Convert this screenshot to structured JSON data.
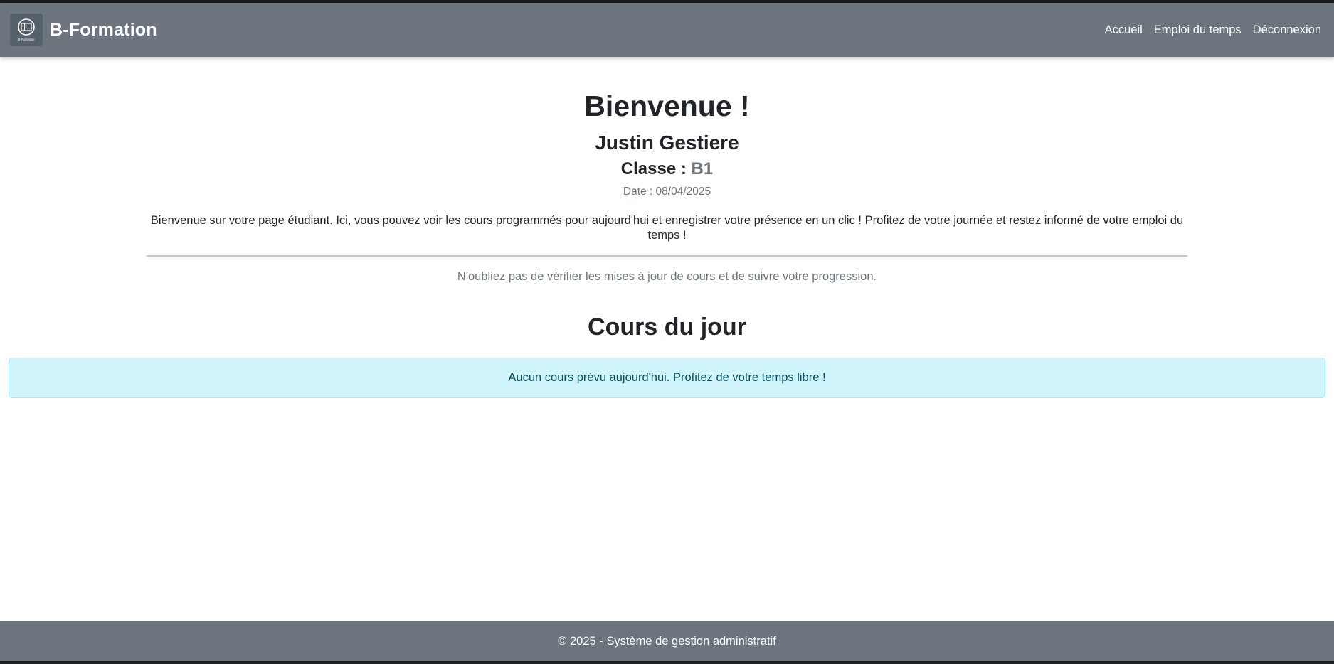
{
  "navbar": {
    "brand": "B-Formation",
    "logo_icon": "b-formation-logo-icon",
    "logo_caption": "B-Formation",
    "links": [
      "Accueil",
      "Emploi du temps",
      "Déconnexion"
    ]
  },
  "welcome": {
    "title": "Bienvenue !",
    "student_name": "Justin Gestiere",
    "class_label": "Classe : ",
    "class_value": "B1",
    "date_text": "Date : 08/04/2025",
    "intro": "Bienvenue sur votre page étudiant. Ici, vous pouvez voir les cours programmés pour aujourd'hui et enregistrer votre présence en un clic ! Profitez de votre journée et restez informé de votre emploi du temps !",
    "reminder": "N'oubliez pas de vérifier les mises à jour de cours et de suivre votre progression."
  },
  "courses": {
    "title": "Cours du jour",
    "empty_message": "Aucun cours prévu aujourd'hui. Profitez de votre temps libre !"
  },
  "footer": {
    "text": "© 2025 - Système de gestion administratif"
  },
  "colors": {
    "navbar_bg": "#6c757d",
    "alert_bg": "#cff4fc",
    "alert_text": "#055160",
    "muted_text": "#6c757d"
  }
}
